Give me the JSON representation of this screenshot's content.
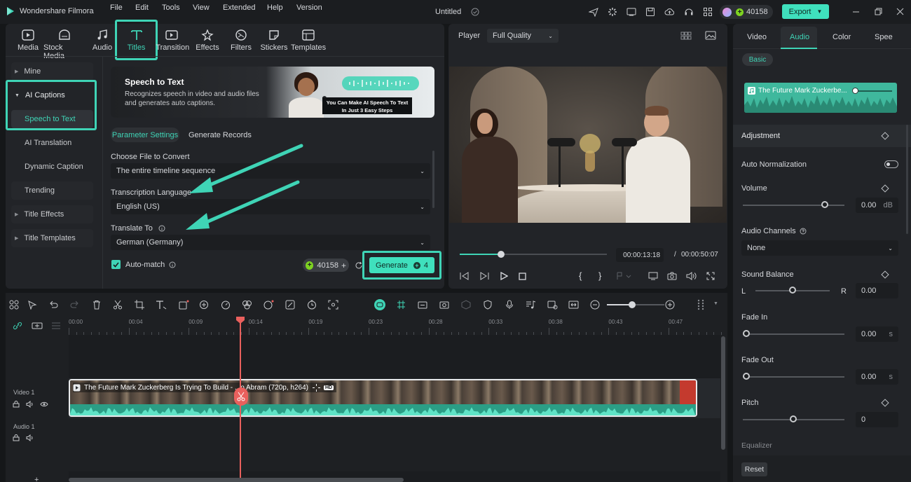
{
  "app": {
    "name": "Wondershare Filmora",
    "project_title": "Untitled"
  },
  "menu": [
    "File",
    "Edit",
    "Tools",
    "View",
    "Extended",
    "Help",
    "Version"
  ],
  "credits": "40158",
  "export_label": "Export",
  "media_tabs": [
    "Media",
    "Stock Media",
    "Audio",
    "Titles",
    "Transitions",
    "Effects",
    "Filters",
    "Stickers",
    "Templates"
  ],
  "sidebar": {
    "mine": "Mine",
    "ai_captions": "AI Captions",
    "speech_to_text": "Speech to Text",
    "ai_translation": "AI Translation",
    "dynamic_caption": "Dynamic Caption",
    "trending": "Trending",
    "title_effects": "Title Effects",
    "title_templates": "Title Templates"
  },
  "banner": {
    "title": "Speech to Text",
    "desc": "Recognizes speech in video and audio files and generates auto captions.",
    "promo_line1": "You Can Make AI Speech To Text",
    "promo_line2": "In Just 3 Easy Steps"
  },
  "stt_tabs": {
    "params": "Parameter Settings",
    "records": "Generate Records"
  },
  "form": {
    "file_label": "Choose File to Convert",
    "file_value": "The entire timeline sequence",
    "lang_label": "Transcription Language",
    "lang_value": "English (US)",
    "translate_label": "Translate To",
    "translate_value": "German (Germany)",
    "automatch": "Auto-match",
    "credits": "40158",
    "generate": "Generate",
    "generate_cost": "4"
  },
  "player": {
    "label": "Player",
    "quality": "Full Quality",
    "current": "00:00:13:18",
    "sep": "/",
    "total": "00:00:50:07",
    "progress": 0.28
  },
  "right": {
    "tabs": [
      "Video",
      "Audio",
      "Color",
      "Speed"
    ],
    "basic": "Basic",
    "clip_name": "The Future Mark Zuckerbe...",
    "adjustment": "Adjustment",
    "auto_norm": "Auto Normalization",
    "volume": "Volume",
    "volume_val": "0.00",
    "volume_unit": "dB",
    "channels": "Audio Channels",
    "channels_val": "None",
    "balance": "Sound Balance",
    "balance_l": "L",
    "balance_r": "R",
    "balance_val": "0.00",
    "fade_in": "Fade In",
    "fade_in_val": "0.00",
    "fade_out": "Fade Out",
    "fade_out_val": "0.00",
    "sec": "s",
    "pitch": "Pitch",
    "pitch_val": "0",
    "equalizer": "Equalizer",
    "reset": "Reset"
  },
  "ruler": [
    "00:00",
    "00:04",
    "00:09",
    "00:14",
    "00:19",
    "00:23",
    "00:28",
    "00:33",
    "00:38",
    "00:43",
    "00:47"
  ],
  "tracks": {
    "video": "Video 1",
    "audio": "Audio 1"
  },
  "clip": {
    "title": "The Future Mark Zuckerberg Is Trying To Build - ...o Abram (720p, h264)",
    "badge": "HD"
  },
  "colors": {
    "accent": "#3fd4b6",
    "playhead": "#e9605d",
    "export": "#3fe0bd"
  }
}
